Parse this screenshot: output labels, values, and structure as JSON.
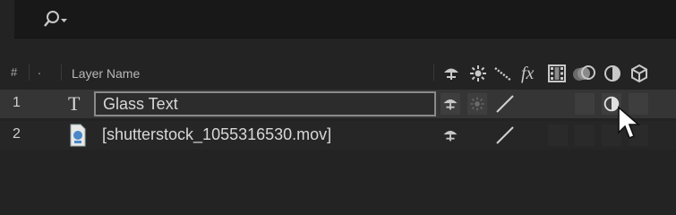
{
  "search": {
    "icon": "search-icon",
    "value": ""
  },
  "columns": {
    "number": "#",
    "label_marker": ".",
    "layer_name": "Layer Name",
    "switch_icons": [
      "shy-icon",
      "collapse-transform-icon",
      "quality-icon",
      "fx-icon",
      "frame-blending-icon",
      "motion-blur-icon",
      "adjustment-layer-icon",
      "3d-layer-icon"
    ],
    "fx_label": "fx"
  },
  "layers": [
    {
      "number": "1",
      "type_icon": "T",
      "name": "Glass Text",
      "editing": true
    },
    {
      "number": "2",
      "type_icon": "footage-icon",
      "name": "[shutterstock_1055316530.mov]",
      "editing": false
    }
  ]
}
